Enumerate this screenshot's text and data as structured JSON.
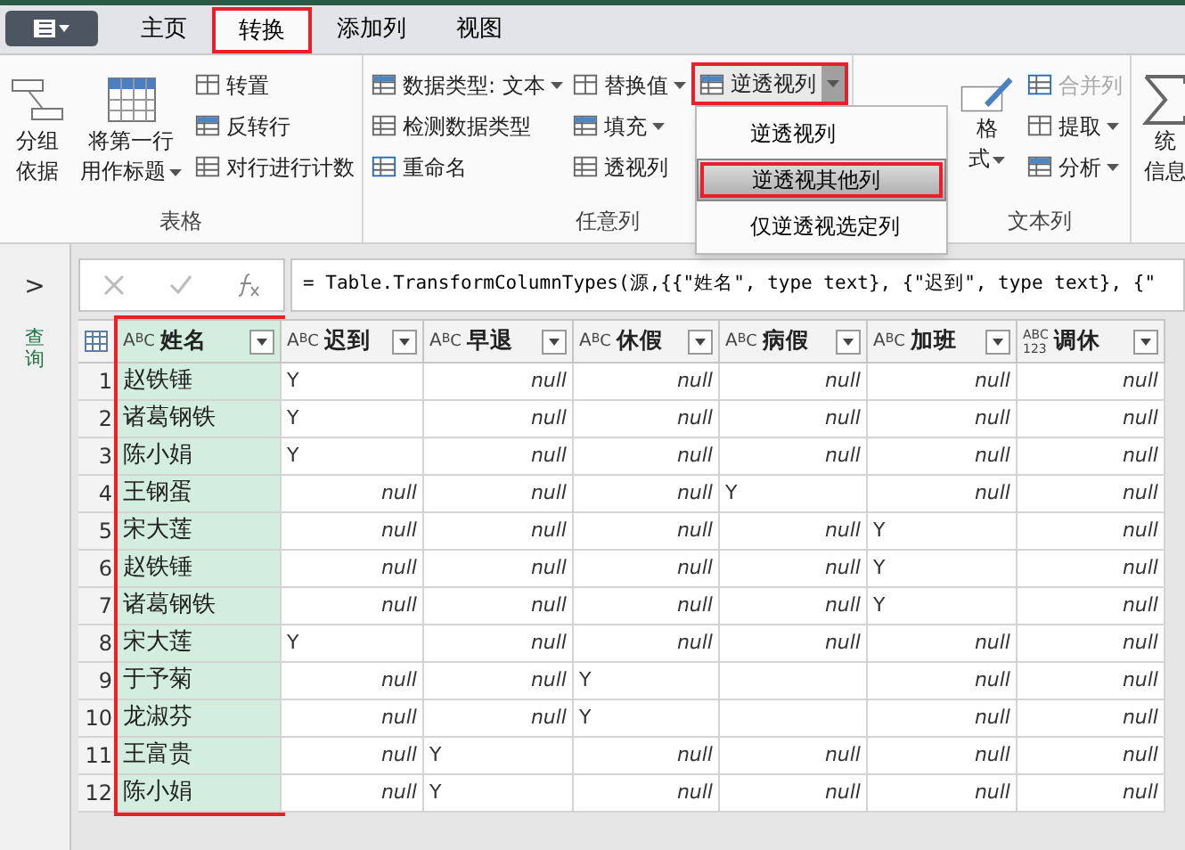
{
  "tabs": [
    {
      "label": "主页",
      "selected": false,
      "annotated": false
    },
    {
      "label": "转换",
      "selected": true,
      "annotated": true
    },
    {
      "label": "添加列",
      "selected": false,
      "annotated": false
    },
    {
      "label": "视图",
      "selected": false,
      "annotated": false
    }
  ],
  "ribbon": {
    "groups": [
      {
        "label": "表格",
        "columns": [
          [
            {
              "kind": "large",
              "lines": [
                "分组",
                "依据"
              ],
              "dropdown": false,
              "disabled": false,
              "annotated": false
            }
          ],
          [
            {
              "kind": "large",
              "lines": [
                "将第一行",
                "用作标题"
              ],
              "dropdown": true,
              "disabled": false,
              "annotated": false
            }
          ],
          [
            {
              "kind": "small",
              "lines": [
                "转置"
              ],
              "dropdown": false,
              "disabled": false,
              "annotated": false
            },
            {
              "kind": "small",
              "lines": [
                "反转行"
              ],
              "dropdown": false,
              "disabled": false,
              "annotated": false
            },
            {
              "kind": "small",
              "lines": [
                "对行进行计数"
              ],
              "dropdown": false,
              "disabled": false,
              "annotated": false
            }
          ]
        ]
      },
      {
        "label": "任意列",
        "columns": [
          [
            {
              "kind": "small",
              "lines": [
                "数据类型: 文本"
              ],
              "dropdown": true,
              "disabled": false,
              "annotated": false
            },
            {
              "kind": "small",
              "lines": [
                "检测数据类型"
              ],
              "dropdown": false,
              "disabled": false,
              "annotated": false
            },
            {
              "kind": "small",
              "lines": [
                "重命名"
              ],
              "dropdown": false,
              "disabled": false,
              "annotated": false
            }
          ],
          [
            {
              "kind": "small",
              "lines": [
                "替换值"
              ],
              "dropdown": true,
              "disabled": false,
              "annotated": false
            },
            {
              "kind": "small",
              "lines": [
                "填充"
              ],
              "dropdown": true,
              "disabled": false,
              "annotated": false
            },
            {
              "kind": "small",
              "lines": [
                "透视列"
              ],
              "dropdown": false,
              "disabled": false,
              "annotated": false
            }
          ],
          [
            {
              "kind": "split",
              "lines": [
                "逆透视列"
              ],
              "dropdown": true,
              "disabled": false,
              "annotated": true
            }
          ]
        ]
      },
      {
        "label": "文本列",
        "columns": [
          [
            {
              "kind": "large",
              "lines": [
                "格",
                "式"
              ],
              "dropdown": true,
              "disabled": false,
              "annotated": false
            }
          ],
          [
            {
              "kind": "small",
              "lines": [
                "合并列"
              ],
              "dropdown": false,
              "disabled": true,
              "annotated": false
            },
            {
              "kind": "small",
              "lines": [
                "提取"
              ],
              "dropdown": true,
              "disabled": false,
              "annotated": false
            },
            {
              "kind": "small",
              "lines": [
                "分析"
              ],
              "dropdown": true,
              "disabled": false,
              "annotated": false
            }
          ]
        ]
      },
      {
        "columns": [
          [
            {
              "kind": "large",
              "lines": [
                "统",
                "信息"
              ],
              "dropdown": false,
              "disabled": false,
              "annotated": false
            }
          ]
        ]
      }
    ]
  },
  "unpivot_menu": {
    "items": [
      {
        "label": "逆透视列",
        "selected": false,
        "annotated": false
      },
      {
        "label": "逆透视其他列",
        "selected": true,
        "annotated": true
      },
      {
        "label": "仅逆透视选定列",
        "selected": false,
        "annotated": false
      }
    ]
  },
  "queries_pane": {
    "expand": ">",
    "label": "查询"
  },
  "formula_bar": {
    "formula": "= Table.TransformColumnTypes(源,{{\"姓名\", type text}, {\"迟到\", type text}, {\""
  },
  "table": {
    "columns": [
      {
        "name": "姓名",
        "kind": "text",
        "type_letters": [
          "A",
          "B",
          "C"
        ],
        "selected": true,
        "annotated": true
      },
      {
        "name": "迟到",
        "kind": "text",
        "type_letters": [
          "A",
          "B",
          "C"
        ],
        "selected": false,
        "annotated": false
      },
      {
        "name": "早退",
        "kind": "text",
        "type_letters": [
          "A",
          "B",
          "C"
        ],
        "selected": false,
        "annotated": false
      },
      {
        "name": "休假",
        "kind": "text",
        "type_letters": [
          "A",
          "B",
          "C"
        ],
        "selected": false,
        "annotated": false
      },
      {
        "name": "病假",
        "kind": "text",
        "type_letters": [
          "A",
          "B",
          "C"
        ],
        "selected": false,
        "annotated": false
      },
      {
        "name": "加班",
        "kind": "text",
        "type_letters": [
          "A",
          "B",
          "C"
        ],
        "selected": false,
        "annotated": false
      },
      {
        "name": "调休",
        "kind": "any",
        "type_letters": [
          "ABC",
          "123"
        ],
        "selected": false,
        "annotated": false
      }
    ],
    "rows": [
      {
        "number": "1",
        "cells": [
          {
            "kind": "name",
            "text": "赵铁锤"
          },
          {
            "kind": "value",
            "text": "Y"
          },
          {
            "kind": "null",
            "text": "null"
          },
          {
            "kind": "null",
            "text": "null"
          },
          {
            "kind": "null",
            "text": "null"
          },
          {
            "kind": "null",
            "text": "null"
          },
          {
            "kind": "null",
            "text": "null"
          }
        ]
      },
      {
        "number": "2",
        "cells": [
          {
            "kind": "name",
            "text": "诸葛钢铁"
          },
          {
            "kind": "value",
            "text": "Y"
          },
          {
            "kind": "null",
            "text": "null"
          },
          {
            "kind": "null",
            "text": "null"
          },
          {
            "kind": "null",
            "text": "null"
          },
          {
            "kind": "null",
            "text": "null"
          },
          {
            "kind": "null",
            "text": "null"
          }
        ]
      },
      {
        "number": "3",
        "cells": [
          {
            "kind": "name",
            "text": "陈小娟"
          },
          {
            "kind": "value",
            "text": "Y"
          },
          {
            "kind": "null",
            "text": "null"
          },
          {
            "kind": "null",
            "text": "null"
          },
          {
            "kind": "null",
            "text": "null"
          },
          {
            "kind": "null",
            "text": "null"
          },
          {
            "kind": "null",
            "text": "null"
          }
        ]
      },
      {
        "number": "4",
        "cells": [
          {
            "kind": "name",
            "text": "王钢蛋"
          },
          {
            "kind": "null",
            "text": "null"
          },
          {
            "kind": "null",
            "text": "null"
          },
          {
            "kind": "null",
            "text": "null"
          },
          {
            "kind": "value",
            "text": "Y"
          },
          {
            "kind": "null",
            "text": "null"
          },
          {
            "kind": "null",
            "text": "null"
          }
        ]
      },
      {
        "number": "5",
        "cells": [
          {
            "kind": "name",
            "text": "宋大莲"
          },
          {
            "kind": "null",
            "text": "null"
          },
          {
            "kind": "null",
            "text": "null"
          },
          {
            "kind": "null",
            "text": "null"
          },
          {
            "kind": "null",
            "text": "null"
          },
          {
            "kind": "value",
            "text": "Y"
          },
          {
            "kind": "null",
            "text": "null"
          }
        ]
      },
      {
        "number": "6",
        "cells": [
          {
            "kind": "name",
            "text": "赵铁锤"
          },
          {
            "kind": "null",
            "text": "null"
          },
          {
            "kind": "null",
            "text": "null"
          },
          {
            "kind": "null",
            "text": "null"
          },
          {
            "kind": "null",
            "text": "null"
          },
          {
            "kind": "value",
            "text": "Y"
          },
          {
            "kind": "null",
            "text": "null"
          }
        ]
      },
      {
        "number": "7",
        "cells": [
          {
            "kind": "name",
            "text": "诸葛钢铁"
          },
          {
            "kind": "null",
            "text": "null"
          },
          {
            "kind": "null",
            "text": "null"
          },
          {
            "kind": "null",
            "text": "null"
          },
          {
            "kind": "null",
            "text": "null"
          },
          {
            "kind": "value",
            "text": "Y"
          },
          {
            "kind": "null",
            "text": "null"
          }
        ]
      },
      {
        "number": "8",
        "cells": [
          {
            "kind": "name",
            "text": "宋大莲"
          },
          {
            "kind": "value",
            "text": "Y"
          },
          {
            "kind": "null",
            "text": "null"
          },
          {
            "kind": "null",
            "text": "null"
          },
          {
            "kind": "null",
            "text": "null"
          },
          {
            "kind": "null",
            "text": "null"
          },
          {
            "kind": "null",
            "text": "null"
          }
        ]
      },
      {
        "number": "9",
        "cells": [
          {
            "kind": "name",
            "text": "于予菊"
          },
          {
            "kind": "null",
            "text": "null"
          },
          {
            "kind": "null",
            "text": "null"
          },
          {
            "kind": "value",
            "text": "Y"
          },
          {
            "kind": "empty"
          },
          {
            "kind": "null",
            "text": "null"
          },
          {
            "kind": "null",
            "text": "null"
          }
        ]
      },
      {
        "number": "10",
        "cells": [
          {
            "kind": "name",
            "text": "龙淑芬"
          },
          {
            "kind": "null",
            "text": "null"
          },
          {
            "kind": "null",
            "text": "null"
          },
          {
            "kind": "value",
            "text": "Y"
          },
          {
            "kind": "empty"
          },
          {
            "kind": "null",
            "text": "null"
          },
          {
            "kind": "null",
            "text": "null"
          }
        ]
      },
      {
        "number": "11",
        "cells": [
          {
            "kind": "name",
            "text": "王富贵"
          },
          {
            "kind": "null",
            "text": "null"
          },
          {
            "kind": "value",
            "text": "Y"
          },
          {
            "kind": "null",
            "text": "null"
          },
          {
            "kind": "null",
            "text": "null"
          },
          {
            "kind": "null",
            "text": "null"
          },
          {
            "kind": "null",
            "text": "null"
          }
        ]
      },
      {
        "number": "12",
        "cells": [
          {
            "kind": "name",
            "text": "陈小娟"
          },
          {
            "kind": "null",
            "text": "null"
          },
          {
            "kind": "value",
            "text": "Y"
          },
          {
            "kind": "null",
            "text": "null"
          },
          {
            "kind": "null",
            "text": "null"
          },
          {
            "kind": "null",
            "text": "null"
          },
          {
            "kind": "null",
            "text": "null"
          }
        ]
      }
    ]
  }
}
